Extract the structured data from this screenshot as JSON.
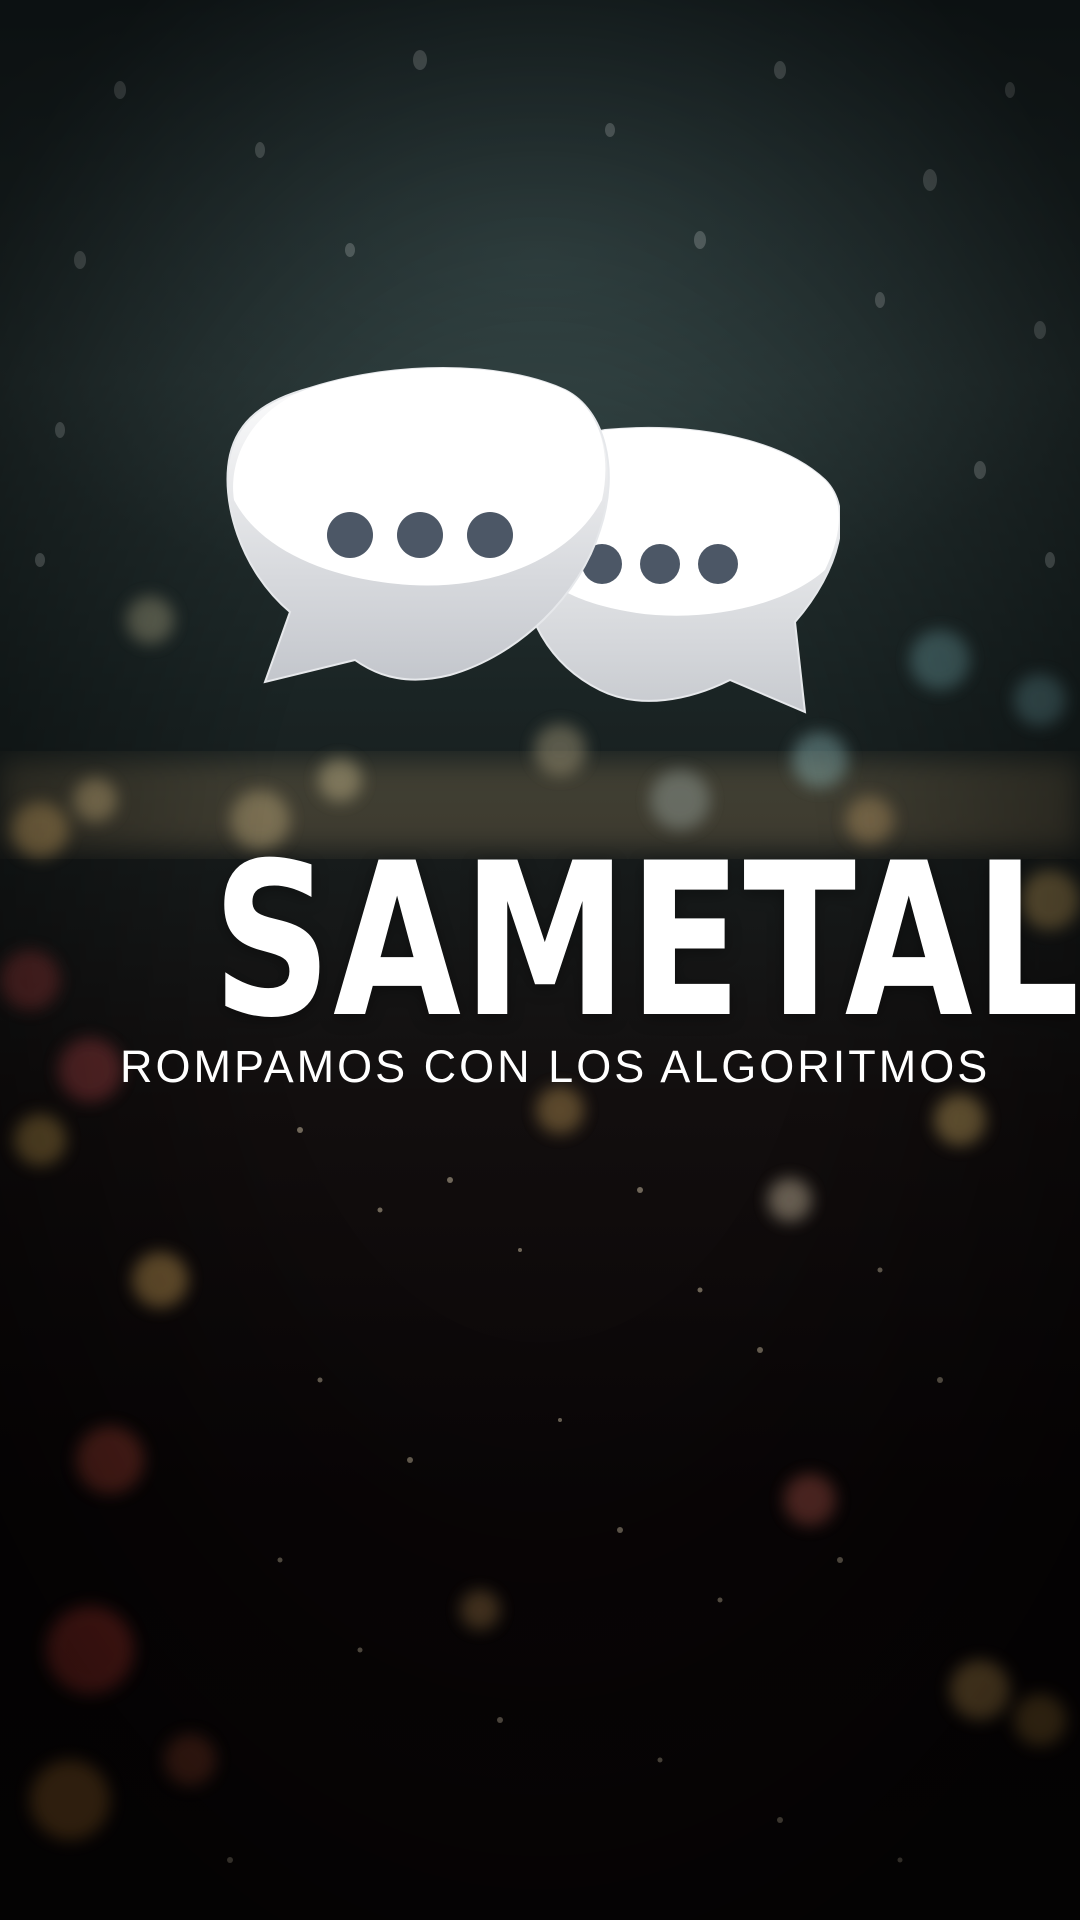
{
  "brand": {
    "name": "SAMETALK",
    "tagline": "ROMPAMOS CON LOS ALGORITMOS",
    "logo_icon": "chat-bubbles-icon"
  },
  "colors": {
    "bubble_fill": "#ffffff",
    "bubble_shade": "#c9ccd1",
    "dot_color": "#4c5766",
    "text": "#ffffff"
  }
}
